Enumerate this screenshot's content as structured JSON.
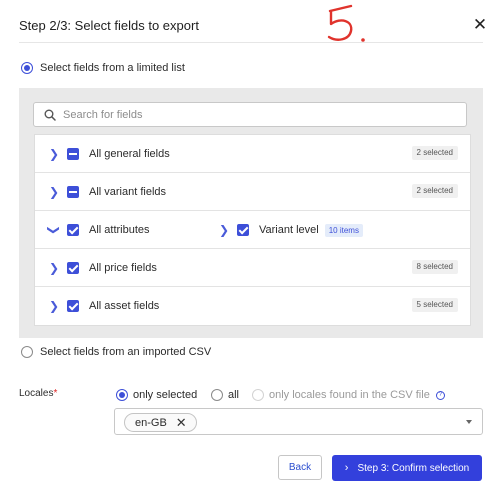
{
  "dialog": {
    "title": "Step 2/3: Select fields to export",
    "close_glyph": "✕",
    "annotation": "5.",
    "colors": {
      "accent": "#3d4fd8",
      "primary_button": "#3340dc",
      "annotation": "#e0332c"
    }
  },
  "source_options": {
    "limited_list": {
      "label": "Select fields from a limited list",
      "selected": true
    },
    "imported_csv": {
      "label": "Select fields from an imported CSV",
      "selected": false
    }
  },
  "search": {
    "placeholder": "Search for fields",
    "value": "",
    "icon": "search-icon"
  },
  "field_groups": [
    {
      "label": "All general fields",
      "state": "partial",
      "badge": "2 selected"
    },
    {
      "label": "All variant fields",
      "state": "partial",
      "badge": "2 selected"
    },
    {
      "label": "All attributes",
      "state": "checked",
      "expanded": true,
      "sub": {
        "label": "Variant level",
        "badge": "10 items",
        "state": "checked"
      }
    },
    {
      "label": "All price fields",
      "state": "checked",
      "badge": "8 selected"
    },
    {
      "label": "All asset fields",
      "state": "checked",
      "badge": "5 selected"
    }
  ],
  "locales": {
    "label": "Locales",
    "required_mark": "*",
    "options": [
      {
        "label": "only selected",
        "selected": true,
        "disabled": false
      },
      {
        "label": "all",
        "selected": false,
        "disabled": false
      },
      {
        "label": "only locales found in the CSV file",
        "selected": false,
        "disabled": true
      }
    ],
    "help_glyph": "?",
    "selected_chips": [
      "en-GB"
    ],
    "chip_remove_glyph": "✕"
  },
  "footer": {
    "back_label": "Back",
    "next_label": "Step 3: Confirm selection",
    "next_arrow": "›"
  }
}
